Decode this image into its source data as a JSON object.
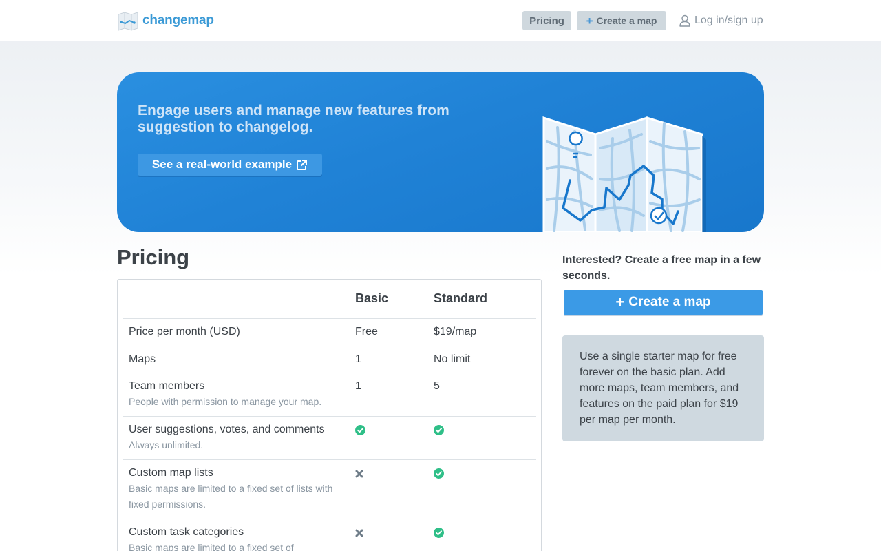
{
  "header": {
    "logo_text": "changemap",
    "nav_pricing": "Pricing",
    "nav_create": "Create a map",
    "nav_login": "Log in/sign up"
  },
  "hero": {
    "title": "Engage users and manage new features from suggestion to changelog.",
    "button": "See a real-world example"
  },
  "pricing": {
    "title": "Pricing",
    "columns": [
      "",
      "Basic",
      "Standard"
    ],
    "rows": [
      {
        "name": "Price per month (USD)",
        "desc": "",
        "basic": "Free",
        "standard": "$19/map"
      },
      {
        "name": "Maps",
        "desc": "",
        "basic": "1",
        "standard": "No limit"
      },
      {
        "name": "Team members",
        "desc": "People with permission to manage your map.",
        "basic": "1",
        "standard": "5"
      },
      {
        "name": "User suggestions, votes, and comments",
        "desc": "Always unlimited.",
        "basic": "check",
        "standard": "check"
      },
      {
        "name": "Custom map lists",
        "desc": "Basic maps are limited to a fixed set of lists with fixed permissions.",
        "basic": "cross",
        "standard": "check"
      },
      {
        "name": "Custom task categories",
        "desc": "Basic maps are limited to a fixed set of",
        "basic": "cross",
        "standard": "check"
      }
    ]
  },
  "sidebar": {
    "prompt": "Interested? Create a free map in a few seconds.",
    "create_button": "Create a map",
    "note": "Use a single starter map for free forever on the basic plan. Add more maps, team members, and features on the paid plan for $19 per map per month."
  },
  "icons": {
    "check": "check-circle-icon",
    "cross": "cross-icon",
    "user": "user-icon",
    "external": "external-link-icon",
    "plus": "plus-icon"
  },
  "colors": {
    "brand": "#3b9ad6",
    "hero_bg": "#2082d6",
    "check": "#2fbf88",
    "cross": "#6f7d89"
  }
}
